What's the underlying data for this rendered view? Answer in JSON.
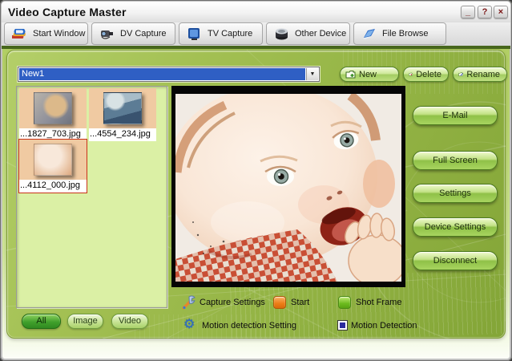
{
  "window": {
    "title": "Video Capture Master",
    "controls": {
      "minimize": "_",
      "help": "?",
      "close": "×"
    }
  },
  "tabs": [
    {
      "label": "Start Window",
      "icon": "books-icon"
    },
    {
      "label": "DV Capture",
      "icon": "camcorder-icon"
    },
    {
      "label": "TV Capture",
      "icon": "tv-icon"
    },
    {
      "label": "Other Device",
      "icon": "device-drum-icon"
    },
    {
      "label": "File Browse",
      "icon": "folder-icon"
    }
  ],
  "group_bar": {
    "selected_group": "New1",
    "dropdown_arrow": "▼",
    "buttons": [
      {
        "label": "New",
        "icon": "folder-plus-icon"
      },
      {
        "label": "Delete",
        "icon": "folder-delete-icon"
      },
      {
        "label": "Rename",
        "icon": "folder-rename-icon"
      }
    ]
  },
  "thumbnails": [
    {
      "filename": "...1827_703.jpg",
      "selected": false
    },
    {
      "filename": "...4554_234.jpg",
      "selected": false
    },
    {
      "filename": "...4112_000.jpg",
      "selected": true
    }
  ],
  "action_buttons": [
    {
      "label": "E-Mail"
    },
    {
      "label": "Full Screen"
    },
    {
      "label": "Settings"
    },
    {
      "label": "Device Settings"
    },
    {
      "label": "Disconnect"
    }
  ],
  "capture": {
    "capture_settings_label": "Capture Settings",
    "start_label": "Start",
    "shot_frame_label": "Shot Frame",
    "motion_setting_label": "Motion detection Setting",
    "motion_detection_label": "Motion Detection",
    "motion_detection_checked": true,
    "gear_glyph": "⚙"
  },
  "filters": [
    {
      "label": "All",
      "active": true
    },
    {
      "label": "Image",
      "active": false
    },
    {
      "label": "Video",
      "active": false
    }
  ],
  "colors": {
    "selection_blue": "#2f5fc4",
    "selected_thumb_border": "#c83318",
    "start_swatch_orange": "#ec7d16",
    "shot_frame_swatch_green": "#6cba1e",
    "checkbox_fill_navy": "#2b2b9e",
    "panel_green": "#94b445",
    "button_green": "#8fc148"
  }
}
